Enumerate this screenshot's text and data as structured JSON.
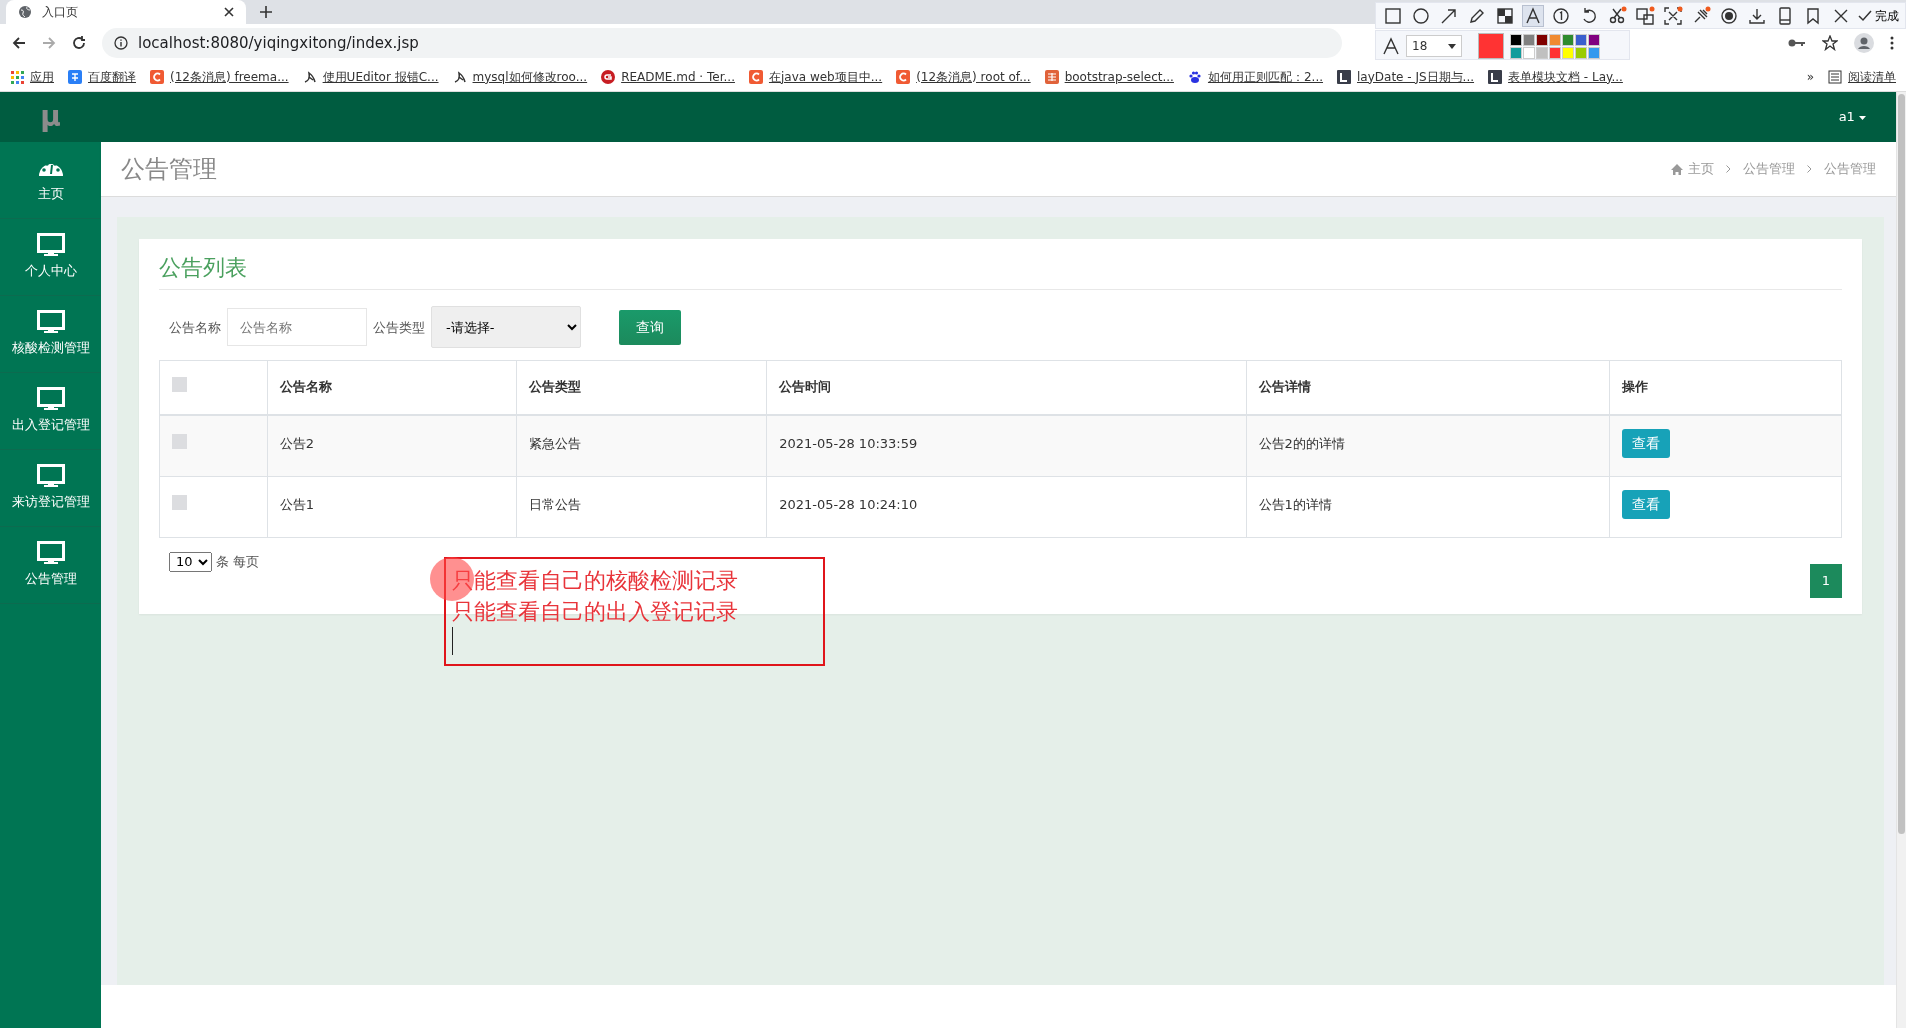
{
  "browser": {
    "tab_title": "入口页",
    "url": "localhost:8080/yiqingxitong/index.jsp",
    "bookmarks": [
      {
        "kind": "apps",
        "label": "应用"
      },
      {
        "kind": "translate",
        "label": "百度翻译"
      },
      {
        "kind": "csdn",
        "label": "(12条消息) freema..."
      },
      {
        "kind": "yuque",
        "label": "使用UEditor 报错C..."
      },
      {
        "kind": "yuque",
        "label": "mysql如何修改roo..."
      },
      {
        "kind": "gitee",
        "label": "README.md · Ter..."
      },
      {
        "kind": "csdn",
        "label": "在java web项目中..."
      },
      {
        "kind": "csdn",
        "label": "(12条消息) root of..."
      },
      {
        "kind": "jian",
        "label": "bootstrap-select..."
      },
      {
        "kind": "baidu",
        "label": "如何用正则匹配：2..."
      },
      {
        "kind": "layui",
        "label": "layDate - JS日期与..."
      },
      {
        "kind": "layui",
        "label": "表单模块文档 - Lay..."
      }
    ],
    "more": "»",
    "reading_list": "阅读清单"
  },
  "capture_toolbar": {
    "font_size": "18",
    "done": "完成"
  },
  "app": {
    "logo": "μ",
    "user": "a1",
    "nav": [
      {
        "kind": "dashboard",
        "label": "主页"
      },
      {
        "kind": "monitor",
        "label": "个人中心"
      },
      {
        "kind": "monitor",
        "label": "核酸检测管理"
      },
      {
        "kind": "monitor",
        "label": "出入登记管理"
      },
      {
        "kind": "monitor",
        "label": "来访登记管理"
      },
      {
        "kind": "monitor",
        "label": "公告管理"
      }
    ]
  },
  "page_title": "公告管理",
  "breadcrumb": [
    "主页",
    "公告管理",
    "公告管理"
  ],
  "card_title": "公告列表",
  "filters": {
    "name_label": "公告名称",
    "name_placeholder": "公告名称",
    "type_label": "公告类型",
    "type_value": "-请选择-",
    "search_button": "查询"
  },
  "table": {
    "select_all": {
      "checked": false
    },
    "columns": [
      "公告名称",
      "公告类型",
      "公告时间",
      "公告详情",
      "操作"
    ],
    "rows": [
      {
        "checked": false,
        "cells": [
          "公告2",
          "紧急公告",
          "2021-05-28 10:33:59",
          "公告2的的详情"
        ],
        "action": "查看"
      },
      {
        "checked": false,
        "cells": [
          "公告1",
          "日常公告",
          "2021-05-28 10:24:10",
          "公告1的详情"
        ],
        "action": "查看"
      }
    ]
  },
  "page_size": "10",
  "page_size_label": "条 每页",
  "pages": [
    {
      "label": "1",
      "selected": true
    }
  ],
  "annotation": {
    "lines": [
      "只能查看自己的核酸检测记录",
      "只能查看自己的出入登记记录"
    ]
  }
}
